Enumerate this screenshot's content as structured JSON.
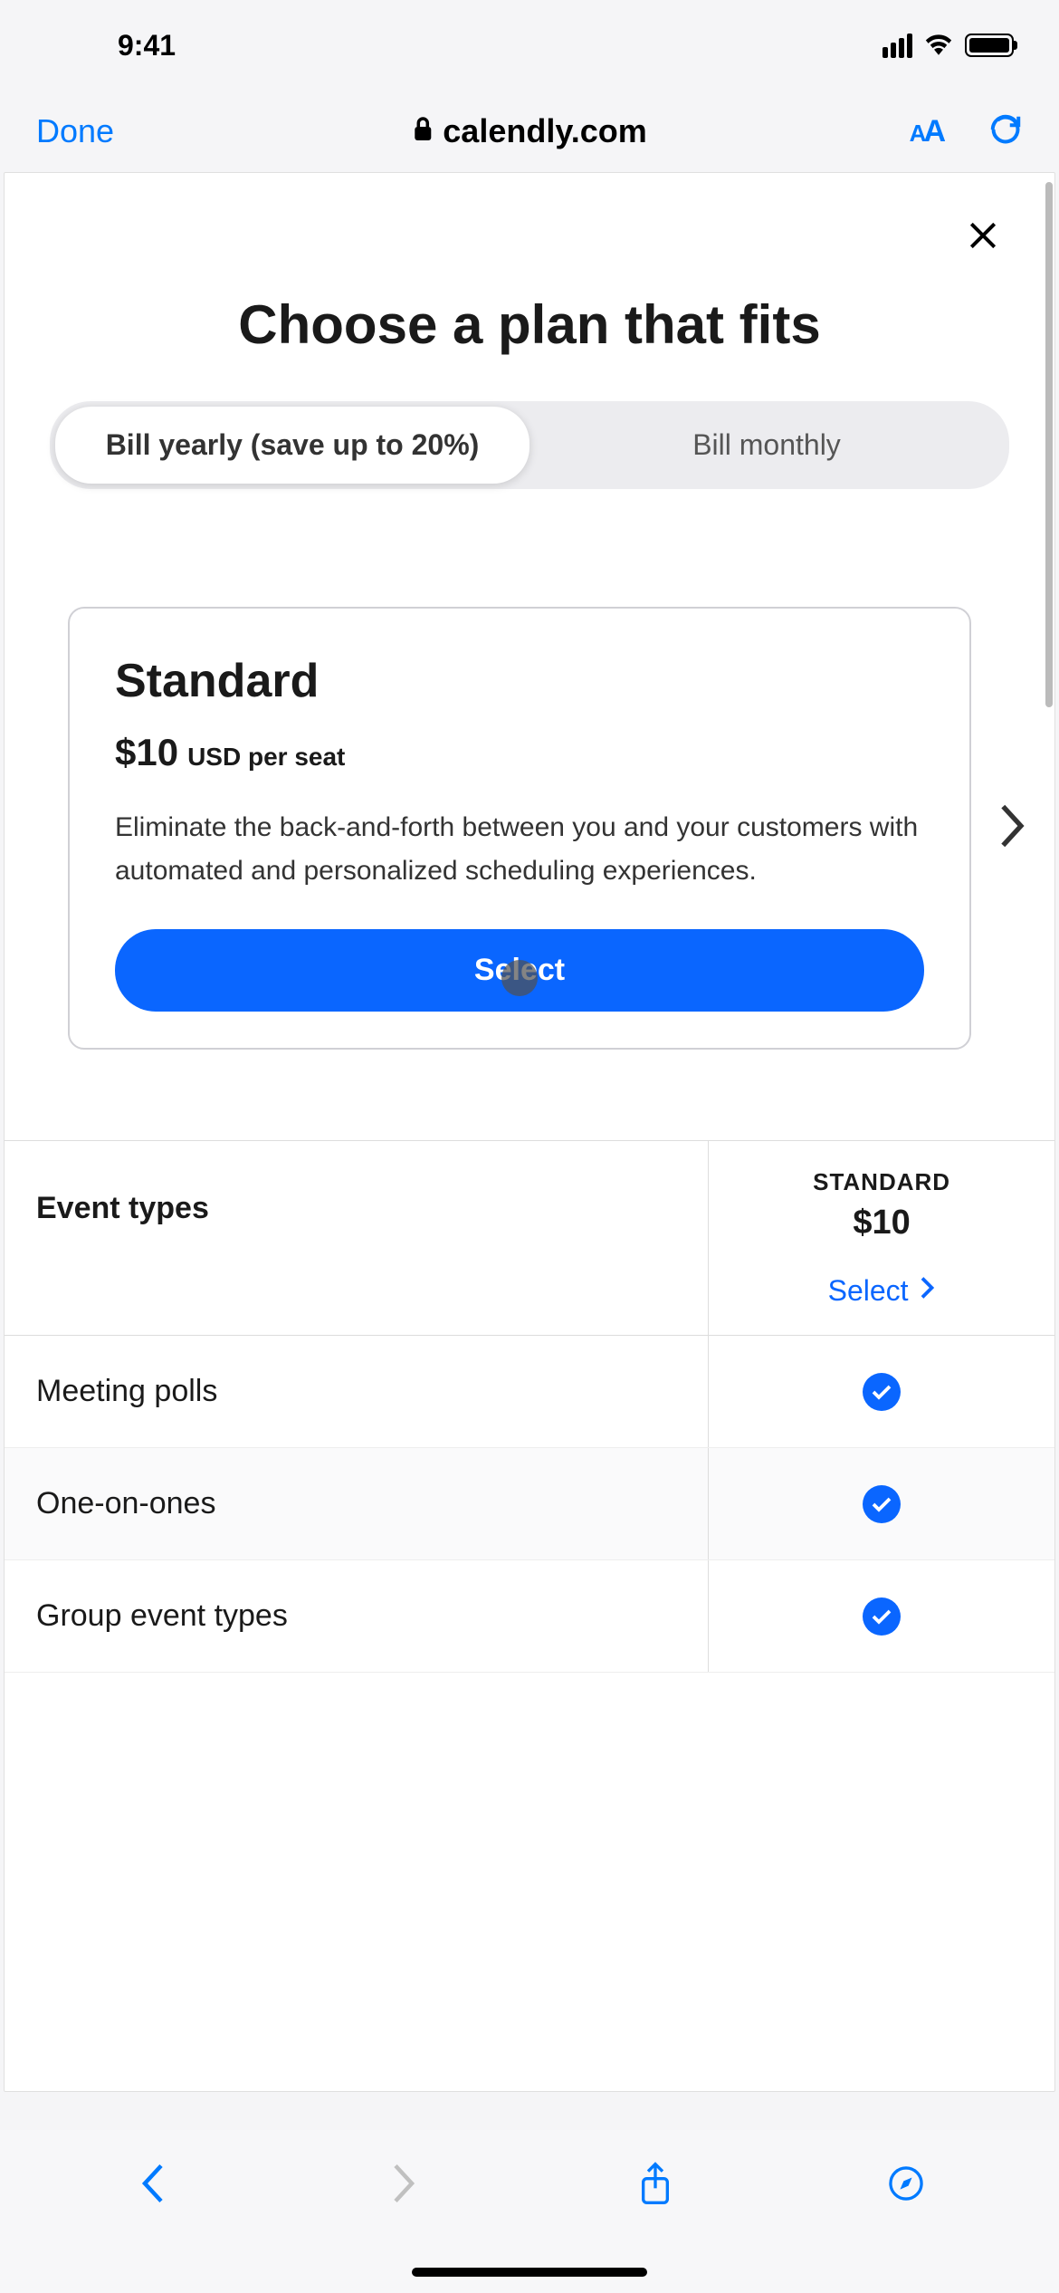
{
  "status": {
    "time": "9:41"
  },
  "browser": {
    "done_label": "Done",
    "url": "calendly.com"
  },
  "page": {
    "title": "Choose a plan that fits",
    "billing": {
      "yearly": "Bill yearly (save up to 20%)",
      "monthly": "Bill monthly"
    },
    "plan": {
      "name": "Standard",
      "price": "$10",
      "price_unit": "USD per seat",
      "description": "Eliminate the back-and-forth between you and your customers with automated and personalized scheduling experiences.",
      "select_label": "Select"
    },
    "table": {
      "category_header": "Event types",
      "column": {
        "name": "STANDARD",
        "price": "$10",
        "select_label": "Select"
      },
      "features": [
        {
          "name": "Meeting polls",
          "included": true
        },
        {
          "name": "One-on-ones",
          "included": true
        },
        {
          "name": "Group event types",
          "included": true
        }
      ]
    }
  }
}
